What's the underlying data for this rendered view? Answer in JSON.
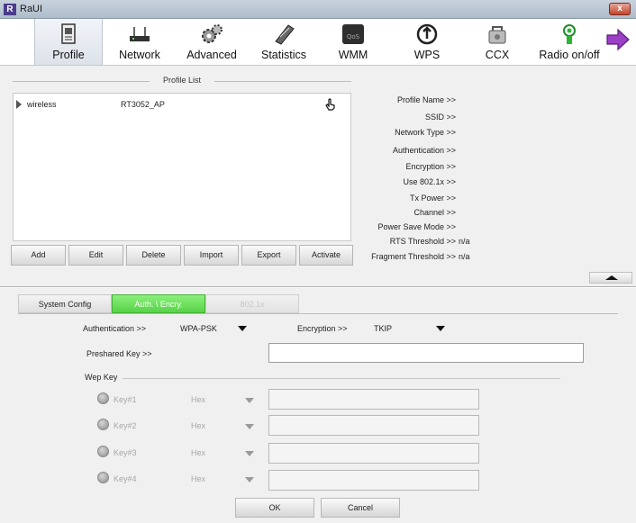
{
  "window": {
    "title": "RaUI",
    "close_glyph": "x",
    "app_icon_glyph": "R"
  },
  "toolbar": {
    "items": [
      {
        "label": "Profile",
        "icon": "profile-icon"
      },
      {
        "label": "Network",
        "icon": "network-icon"
      },
      {
        "label": "Advanced",
        "icon": "advanced-gears-icon"
      },
      {
        "label": "Statistics",
        "icon": "statistics-icon"
      },
      {
        "label": "WMM",
        "icon": "wmm-icon"
      },
      {
        "label": "WPS",
        "icon": "wps-icon"
      },
      {
        "label": "CCX",
        "icon": "ccx-icon"
      },
      {
        "label": "Radio on/off",
        "icon": "radio-antenna-icon"
      }
    ],
    "active": "Profile",
    "next_icon": "next-arrow-icon"
  },
  "profile_list": {
    "legend": "Profile List",
    "rows": [
      {
        "name": "wireless",
        "ssid": "RT3052_AP",
        "status_icon": "hand-pointer-icon"
      }
    ],
    "buttons": [
      "Add",
      "Edit",
      "Delete",
      "Import",
      "Export",
      "Activate"
    ]
  },
  "details": [
    {
      "label": "Profile Name >>",
      "value": ""
    },
    {
      "label": "SSID >>",
      "value": ""
    },
    {
      "label": "Network Type >>",
      "value": ""
    },
    {
      "label": "Authentication >>",
      "value": ""
    },
    {
      "label": "Encryption >>",
      "value": ""
    },
    {
      "label": "Use 802.1x >>",
      "value": ""
    },
    {
      "label": "Tx Power >>",
      "value": ""
    },
    {
      "label": "Channel >>",
      "value": ""
    },
    {
      "label": "Power Save Mode >>",
      "value": ""
    },
    {
      "label": "RTS Threshold >>",
      "value": "n/a"
    },
    {
      "label": "Fragment Threshold >>",
      "value": "n/a"
    }
  ],
  "tabs": [
    {
      "label": "System Config",
      "state": "normal"
    },
    {
      "label": "Auth. \\ Encry.",
      "state": "selected"
    },
    {
      "label": "802.1x",
      "state": "disabled"
    }
  ],
  "auth": {
    "authentication_label": "Authentication >>",
    "authentication_value": "WPA-PSK",
    "encryption_label": "Encryption >>",
    "encryption_value": "TKIP",
    "preshared_label": "Preshared Key >>",
    "preshared_value": ""
  },
  "wep": {
    "legend": "Wep Key",
    "keys": [
      {
        "label": "Key#1",
        "format": "Hex",
        "value": ""
      },
      {
        "label": "Key#2",
        "format": "Hex",
        "value": ""
      },
      {
        "label": "Key#3",
        "format": "Hex",
        "value": ""
      },
      {
        "label": "Key#4",
        "format": "Hex",
        "value": ""
      }
    ]
  },
  "footer": {
    "ok": "OK",
    "cancel": "Cancel"
  },
  "colors": {
    "selected_tab": "#58d248",
    "close_button": "#c4432b",
    "app_icon": "#4b3c8c",
    "next_arrow": "#9b3fc7"
  }
}
